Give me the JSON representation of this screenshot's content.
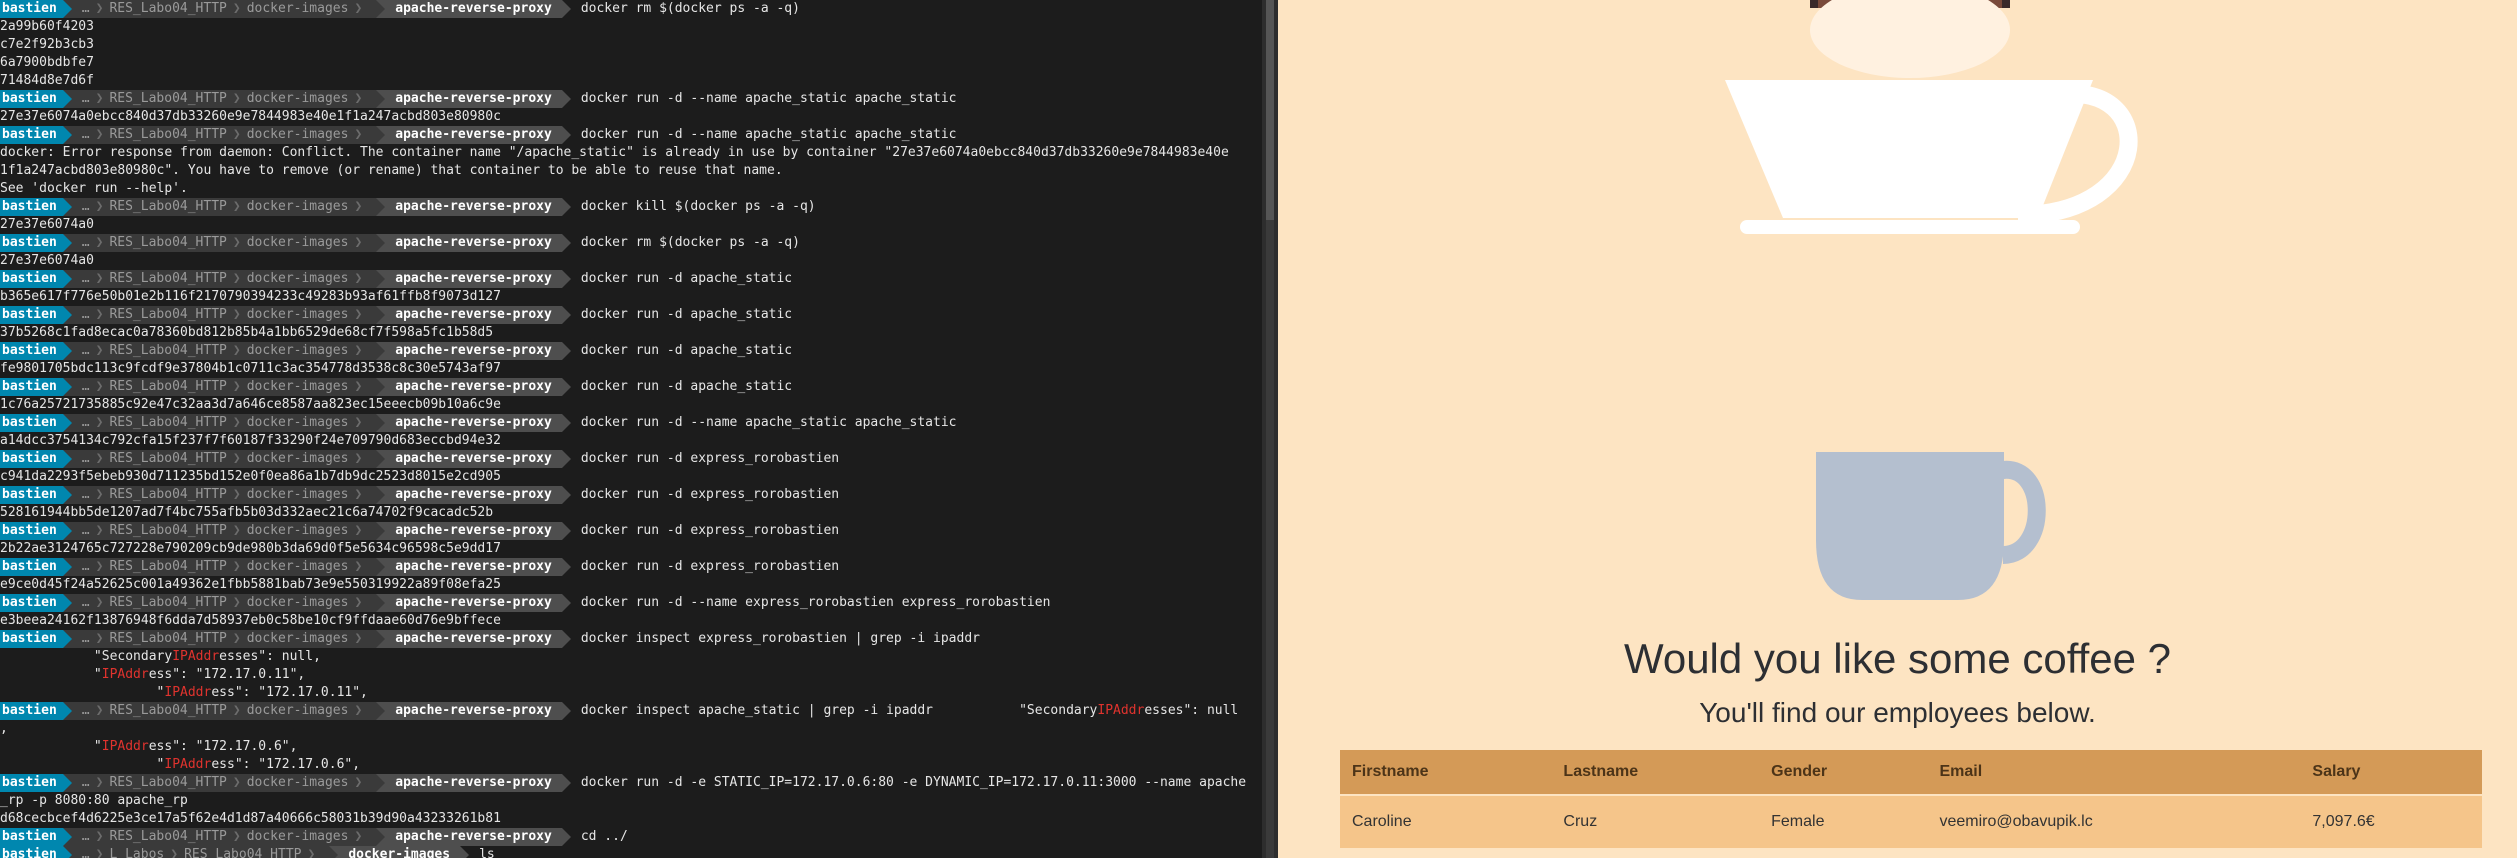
{
  "terminal": {
    "prompt": {
      "user": "bastien",
      "ellipsis": "…",
      "dir1": "RES_Labo04_HTTP",
      "dir2": "docker-images",
      "current": "apache-reverse-proxy"
    },
    "lines": [
      {
        "t": "p",
        "cmd": "docker rm $(docker ps -a -q)"
      },
      {
        "t": "o",
        "text": "2a99b60f4203"
      },
      {
        "t": "o",
        "text": "c7e2f92b3cb3"
      },
      {
        "t": "o",
        "text": "6a7900bdbfe7"
      },
      {
        "t": "o",
        "text": "71484d8e7d6f"
      },
      {
        "t": "p",
        "cmd": "docker run -d --name apache_static apache_static"
      },
      {
        "t": "o",
        "text": "27e37e6074a0ebcc840d37db33260e9e7844983e40e1f1a247acbd803e80980c"
      },
      {
        "t": "p",
        "cmd": "docker run -d --name apache_static apache_static"
      },
      {
        "t": "o",
        "text": "docker: Error response from daemon: Conflict. The container name \"/apache_static\" is already in use by container \"27e37e6074a0ebcc840d37db33260e9e7844983e40e"
      },
      {
        "t": "o",
        "text": "1f1a247acbd803e80980c\". You have to remove (or rename) that container to be able to reuse that name."
      },
      {
        "t": "o",
        "text": "See 'docker run --help'."
      },
      {
        "t": "p",
        "cmd": "docker kill $(docker ps -a -q)"
      },
      {
        "t": "o",
        "text": "27e37e6074a0"
      },
      {
        "t": "p",
        "cmd": "docker rm $(docker ps -a -q)"
      },
      {
        "t": "o",
        "text": "27e37e6074a0"
      },
      {
        "t": "p",
        "cmd": "docker run -d apache_static"
      },
      {
        "t": "o",
        "text": "b365e617f776e50b01e2b116f2170790394233c49283b93af61ffb8f9073d127"
      },
      {
        "t": "p",
        "cmd": "docker run -d apache_static"
      },
      {
        "t": "o",
        "text": "37b5268c1fad8ecac0a78360bd812b85b4a1bb6529de68cf7f598a5fc1b58d5"
      },
      {
        "t": "p",
        "cmd": "docker run -d apache_static"
      },
      {
        "t": "o",
        "text": "fe9801705bdc113c9fcdf9e37804b1c0711c3ac354778d3538c8c30e5743af97"
      },
      {
        "t": "p",
        "cmd": "docker run -d apache_static"
      },
      {
        "t": "o",
        "text": "1c76a25721735885c92e47c32aa3d7a646ce8587aa823ec15eeecb09b10a6c9e"
      },
      {
        "t": "p",
        "cmd": "docker run -d --name apache_static apache_static"
      },
      {
        "t": "o",
        "text": "a14dcc3754134c792cfa15f237f7f60187f33290f24e709790d683eccbd94e32"
      },
      {
        "t": "p",
        "cmd": "docker run -d express_rorobastien"
      },
      {
        "t": "o",
        "text": "c941da2293f5ebeb930d711235bd152e0f0ea86a1b7db9dc2523d8015e2cd905"
      },
      {
        "t": "p",
        "cmd": "docker run -d express_rorobastien"
      },
      {
        "t": "o",
        "text": "528161944bb5de1207ad7f4bc755afb5b03d332aec21c6a74702f9cacadc52b"
      },
      {
        "t": "p",
        "cmd": "docker run -d express_rorobastien"
      },
      {
        "t": "o",
        "text": "2b22ae3124765c727228e790209cb9de980b3da69d0f5e5634c96598c5e9dd17"
      },
      {
        "t": "p",
        "cmd": "docker run -d express_rorobastien"
      },
      {
        "t": "o",
        "text": "e9ce0d45f24a52625c001a49362e1fbb5881bab73e9e550319922a89f08efa25"
      },
      {
        "t": "p",
        "cmd": "docker run -d --name express_rorobastien express_rorobastien"
      },
      {
        "t": "o",
        "text": "e3beea24162f13876948f6dda7d58937eb0c58be10cf9ffdaae60d76e9bffece"
      },
      {
        "t": "p",
        "cmd": "docker inspect express_rorobastien | grep -i ipaddr"
      },
      {
        "t": "h",
        "pre": "            \"Secondary",
        "hl": "IPAddr",
        "post": "esses\": null,"
      },
      {
        "t": "h",
        "pre": "            \"",
        "hl": "IPAddr",
        "post": "ess\": \"172.17.0.11\","
      },
      {
        "t": "h",
        "pre": "                    \"",
        "hl": "IPAddr",
        "post": "ess\": \"172.17.0.11\","
      },
      {
        "t": "p",
        "cmd": "docker inspect apache_static | grep -i ipaddr           \"Secondary",
        "hl": "IPAddr",
        "post": "esses\": null"
      },
      {
        "t": "o",
        "text": ","
      },
      {
        "t": "h",
        "pre": "            \"",
        "hl": "IPAddr",
        "post": "ess\": \"172.17.0.6\","
      },
      {
        "t": "h",
        "pre": "                    \"",
        "hl": "IPAddr",
        "post": "ess\": \"172.17.0.6\","
      },
      {
        "t": "p",
        "cmd": "docker run -d -e STATIC_IP=172.17.0.6:80 -e DYNAMIC_IP=172.17.0.11:3000 --name apache"
      },
      {
        "t": "o",
        "text": "_rp -p 8080:80 apache_rp"
      },
      {
        "t": "o",
        "text": "d68cecbcef4d6225e3ce17a5f62e4d1d87a40666c58031b39d90a43233261b81"
      },
      {
        "t": "p",
        "cmd": "cd ../"
      },
      {
        "t": "p2",
        "cmd": "ls"
      }
    ],
    "prompt2": {
      "dir0": "L_Labos",
      "dir1": "RES_Labo04_HTTP",
      "current": "docker-images"
    }
  },
  "browser": {
    "headline": "Would you like some coffee ?",
    "subheadline": "You'll find our employees below.",
    "table": {
      "headers": [
        "Firstname",
        "Lastname",
        "Gender",
        "Email",
        "Salary"
      ],
      "rows": [
        [
          "Caroline",
          "Cruz",
          "Female",
          "veemiro@obavupik.lc",
          "7,097.6€"
        ]
      ]
    },
    "colors": {
      "background": "#fde4c2",
      "cup_white": "#ffffff",
      "mug": "#b4bfcf",
      "header_row": "#d49a57",
      "body_row": "#f5c58a",
      "prompt_user": "#0087af"
    }
  }
}
